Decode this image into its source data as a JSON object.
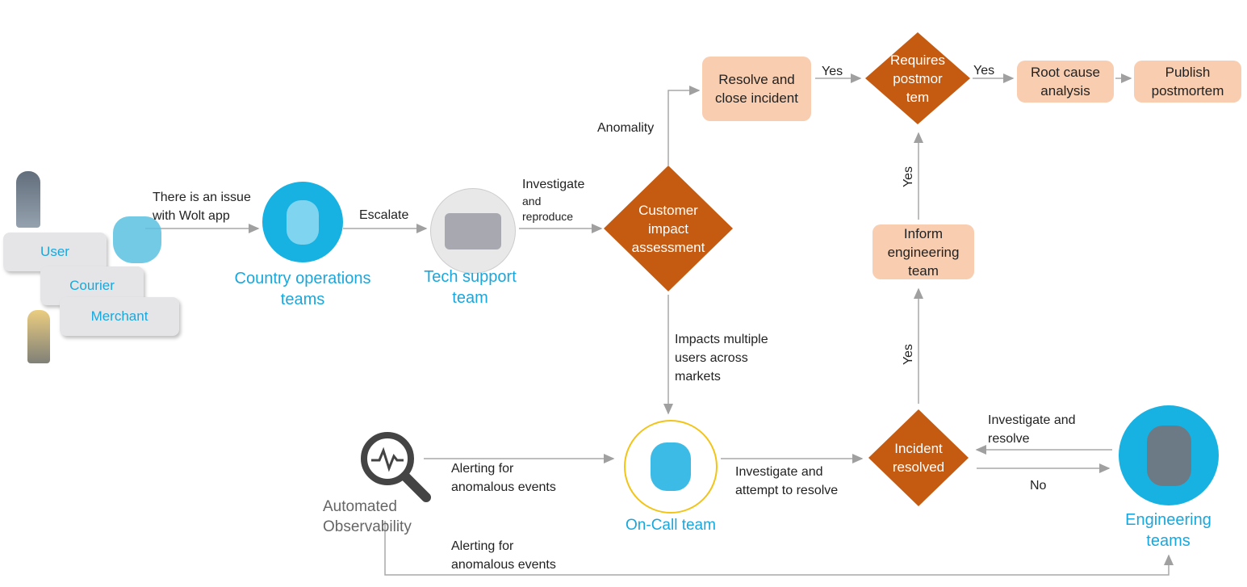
{
  "colors": {
    "process_box": "#f8cdb0",
    "decision": "#c55a11",
    "team_blue": "#1aa7dc",
    "arrow": "#a0a0a0",
    "oncall_ring": "#f2c418"
  },
  "actors": {
    "user": "User",
    "courier": "Courier",
    "merchant": "Merchant"
  },
  "teams": {
    "country_ops": "Country operations teams",
    "tech_support": "Tech support team",
    "on_call": "On-Call team",
    "engineering": "Engineering teams",
    "observability": "Automated Observability"
  },
  "boxes": {
    "resolve_close": "Resolve and close incident",
    "root_cause": "Root cause analysis",
    "publish": "Publish postmortem",
    "inform": "Inform engineering team"
  },
  "decisions": {
    "requires_postmortem": "Requires postmor tem",
    "customer_impact": "Customer impact assessment",
    "incident_resolved": "Incident resolved"
  },
  "edges": {
    "issue": "There is an issue with Wolt app",
    "escalate": "Escalate",
    "investigate": "Investigate",
    "and_reproduce": "and reproduce",
    "anomality": "Anomality",
    "yes1": "Yes",
    "yes2": "Yes",
    "yes3": "Yes",
    "yes4": "Yes",
    "impacts": "Impacts multiple users across markets",
    "alerting1": "Alerting for anomalous events",
    "alerting2": "Alerting for anomalous events",
    "attempt": "Investigate and attempt to resolve",
    "investigate_resolve": "Investigate and resolve",
    "no": "No"
  },
  "icons": {
    "observability": "magnifier-pulse-icon",
    "mascot": "wolt-deer-mascot"
  }
}
